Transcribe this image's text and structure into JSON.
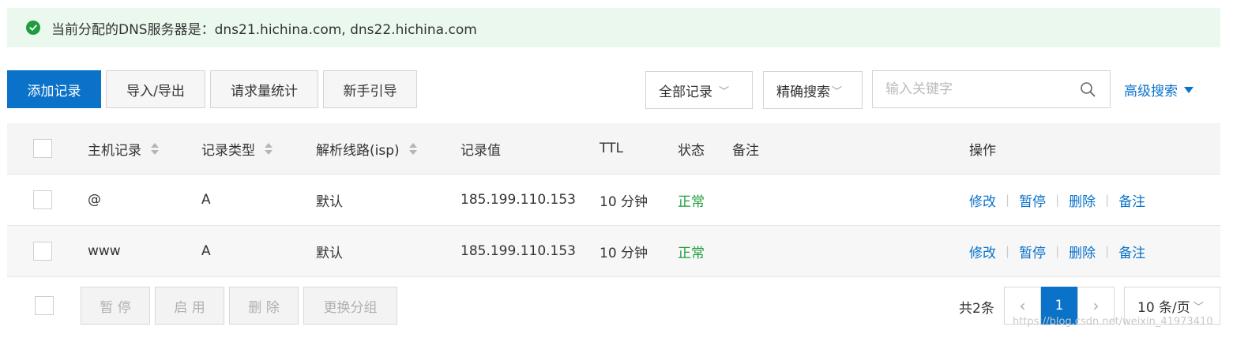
{
  "notice": {
    "text": "当前分配的DNS服务器是：dns21.hichina.com, dns22.hichina.com"
  },
  "toolbar": {
    "add": "添加记录",
    "import_export": "导入/导出",
    "stats": "请求量统计",
    "guide": "新手引导",
    "record_filter": "全部记录",
    "search_mode": "精确搜索",
    "search_placeholder": "输入关键字",
    "advanced": "高级搜索"
  },
  "table": {
    "headers": {
      "host": "主机记录",
      "type": "记录类型",
      "line": "解析线路(isp)",
      "value": "记录值",
      "ttl": "TTL",
      "status": "状态",
      "remark": "备注",
      "actions": "操作"
    },
    "rows": [
      {
        "host": "@",
        "type": "A",
        "line": "默认",
        "value": "185.199.110.153",
        "ttl": "10 分钟",
        "status": "正常",
        "actions": {
          "edit": "修改",
          "pause": "暂停",
          "delete": "删除",
          "note": "备注"
        }
      },
      {
        "host": "www",
        "type": "A",
        "line": "默认",
        "value": "185.199.110.153",
        "ttl": "10 分钟",
        "status": "正常",
        "actions": {
          "edit": "修改",
          "pause": "暂停",
          "delete": "删除",
          "note": "备注"
        }
      }
    ]
  },
  "footer": {
    "pause": "暂 停",
    "enable": "启 用",
    "delete": "删 除",
    "change_group": "更换分组",
    "total": "共2条",
    "current_page": "1",
    "page_size": "10 条/页"
  },
  "watermark": "https://blog.csdn.net/weixin_41973410",
  "colors": {
    "primary": "#0a72c9",
    "success": "#1f9d3e",
    "notice_bg": "#ebf8ee"
  }
}
